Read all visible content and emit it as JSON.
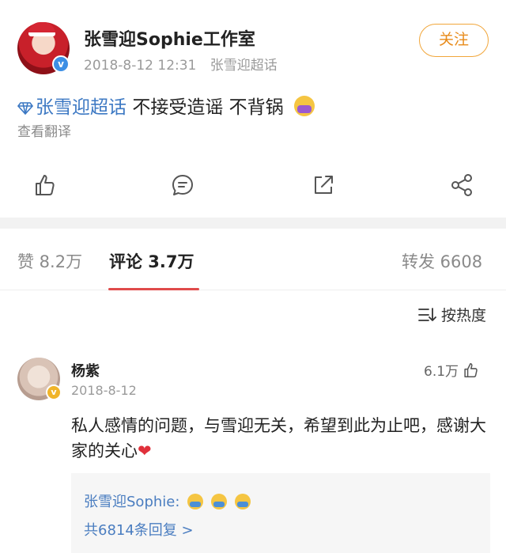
{
  "post": {
    "author": "张雪迎Sophie工作室",
    "timestamp": "2018-8-12 12:31",
    "source": "张雪迎超话",
    "follow_label": "关注",
    "topic": "张雪迎超话",
    "body_text": "不接受造谣 不背锅",
    "translate_label": "查看翻译"
  },
  "actions": [
    "like-icon",
    "comment-icon",
    "repost-icon",
    "share-icon"
  ],
  "tabs": {
    "likes": "赞 8.2万",
    "comments": "评论 3.7万",
    "reposts": "转发 6608"
  },
  "sort": {
    "label": "按热度"
  },
  "comment": {
    "name": "杨紫",
    "date": "2018-8-12",
    "likes": "6.1万",
    "text": "私人感情的问题，与雪迎无关，希望到此为止吧，感谢大家的关心",
    "heart": "❤"
  },
  "reply": {
    "author_prefix": "张雪迎Sophie:",
    "count_label": "共6814条回复 >"
  },
  "colors": {
    "accent_orange": "#e88b1a",
    "link_blue": "#3c78c3",
    "tab_underline": "#e04b4b"
  }
}
